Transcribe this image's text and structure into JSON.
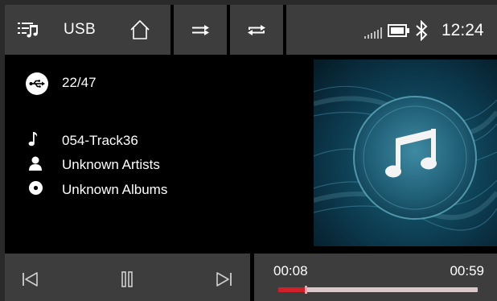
{
  "topbar": {
    "source_label": "USB",
    "clock": "12:24",
    "icons": [
      "playlist-icon",
      "home-icon",
      "shuffle-icon",
      "repeat-icon",
      "signal-icon",
      "battery-icon",
      "bluetooth-icon"
    ]
  },
  "info": {
    "track_count": "22/47",
    "track_name": "054-Track36",
    "artist": "Unknown Artists",
    "album": "Unknown Albums"
  },
  "player": {
    "elapsed": "00:08",
    "total": "00:59",
    "progress_fraction": 0.136
  },
  "colors": {
    "panel": "#3d3d3d",
    "background": "#000000",
    "progress_fill": "#d0212b",
    "progress_track": "#d9c8cc",
    "album_art_base": "#0d3a4c"
  }
}
